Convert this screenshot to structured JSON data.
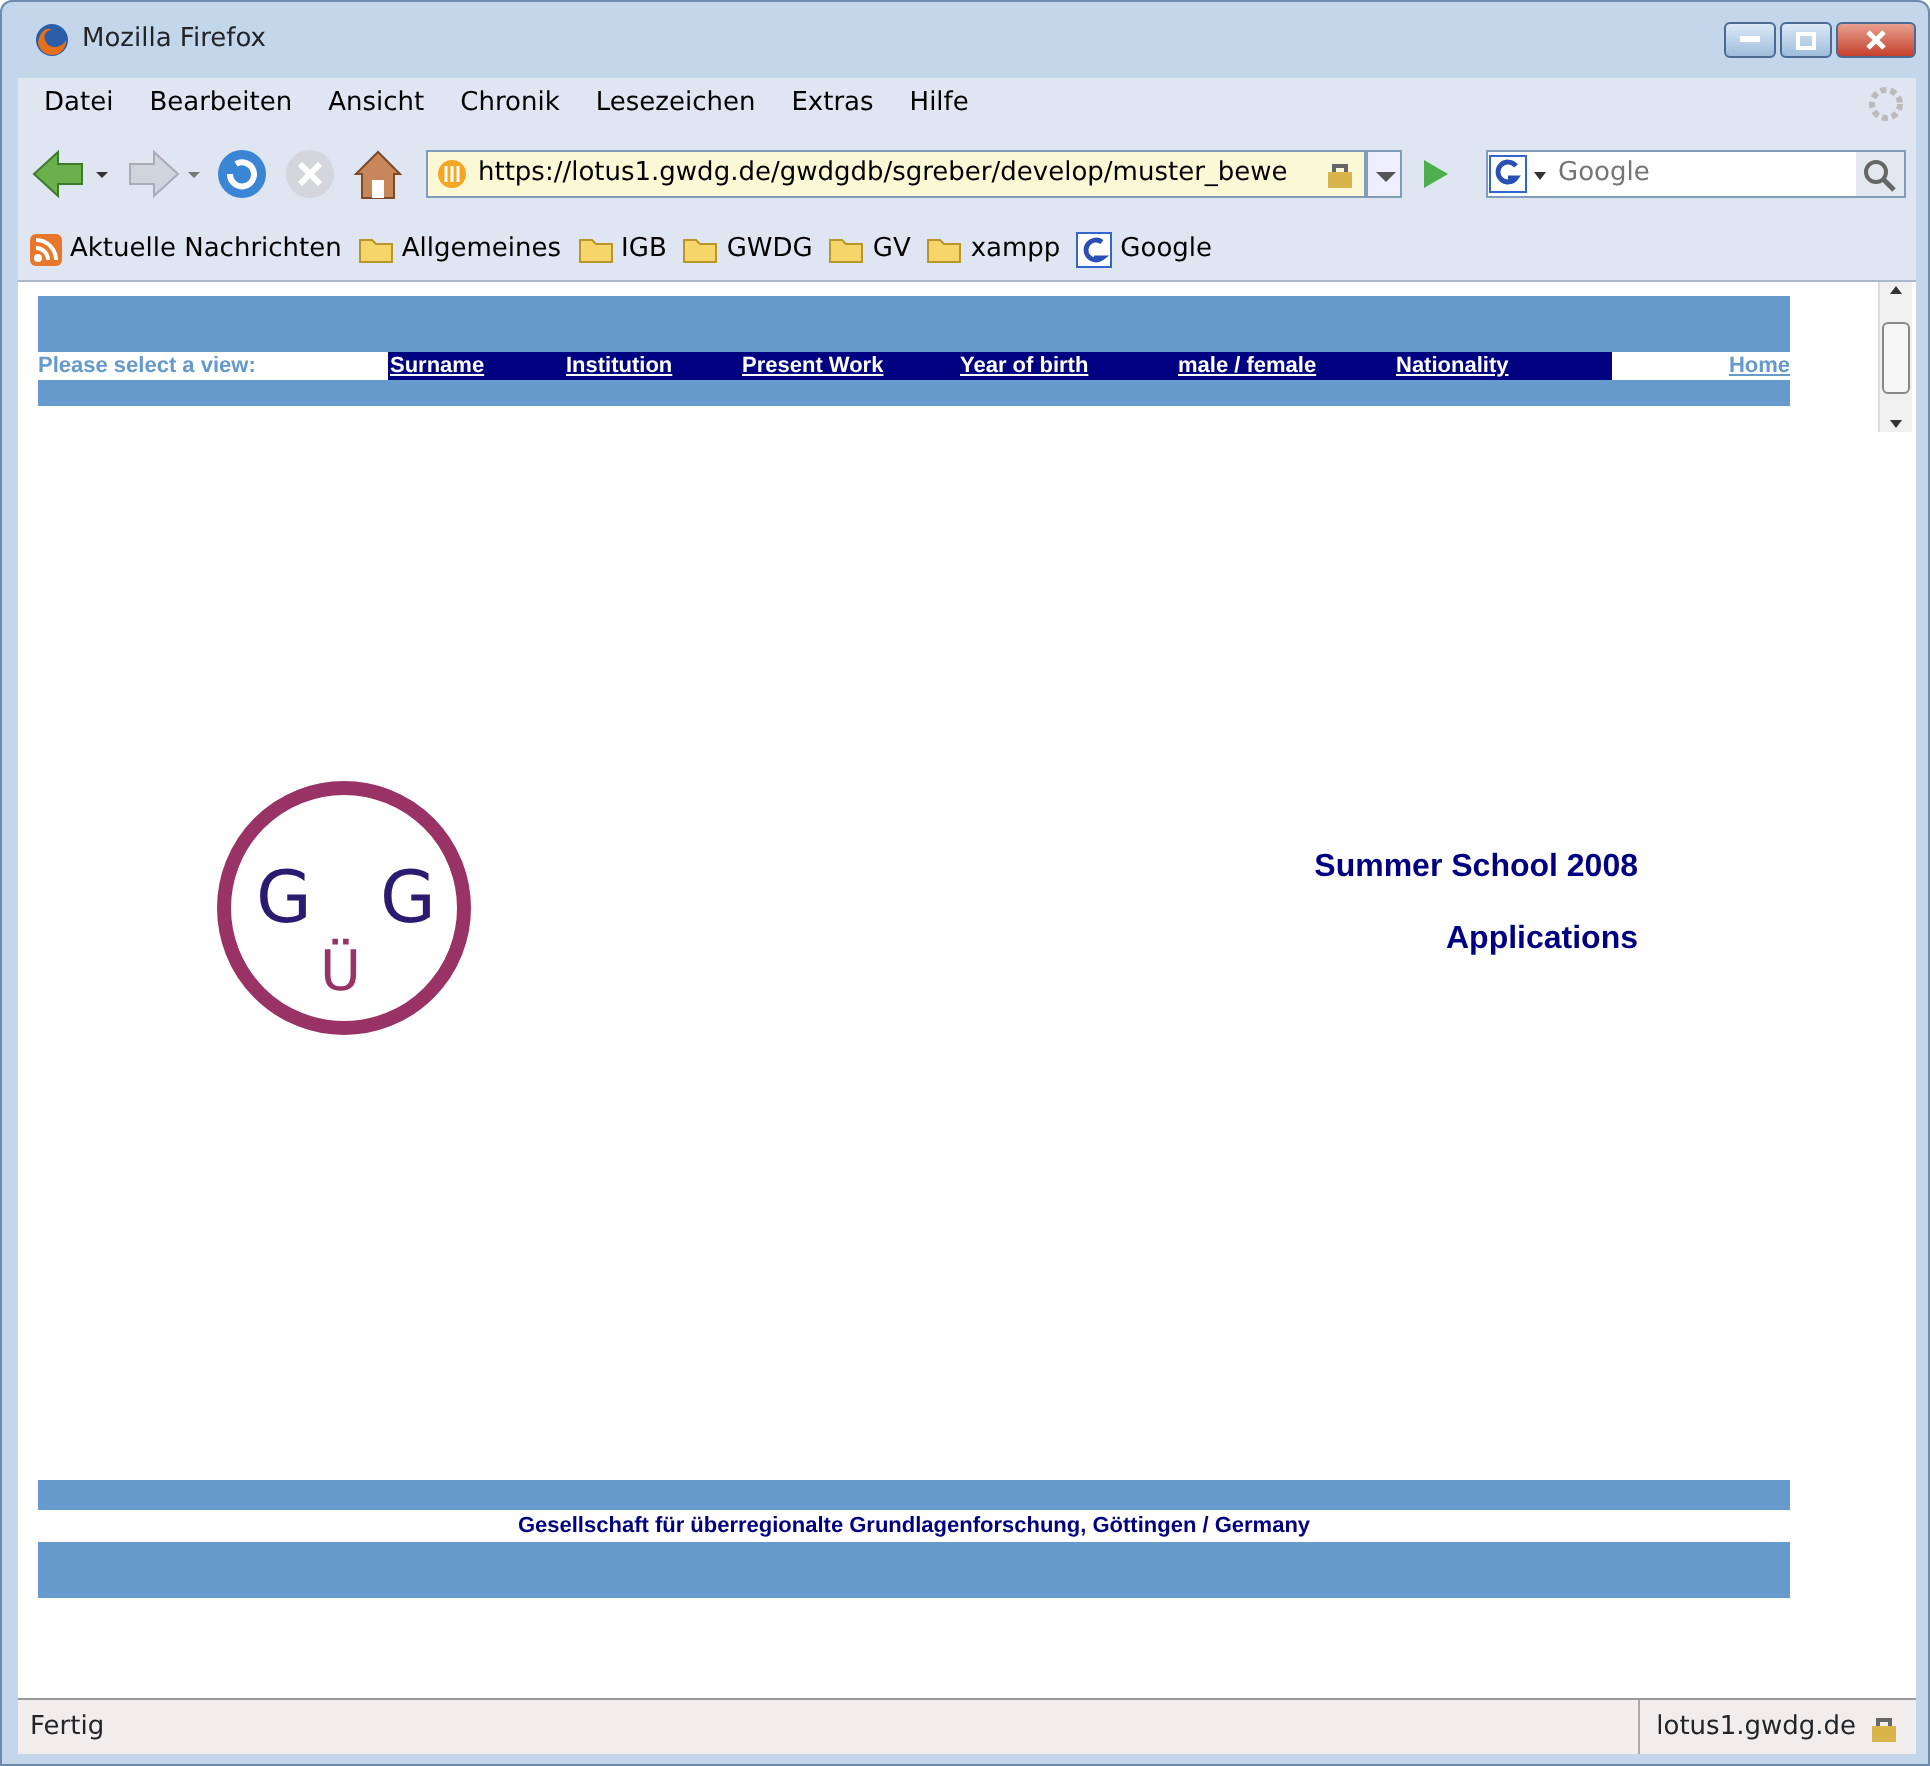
{
  "window": {
    "title": "Mozilla Firefox"
  },
  "menu": [
    "Datei",
    "Bearbeiten",
    "Ansicht",
    "Chronik",
    "Lesezeichen",
    "Extras",
    "Hilfe"
  ],
  "address_bar": {
    "value": "https://lotus1.gwdg.de/gwdgdb/sgreber/develop/muster_bewe"
  },
  "search": {
    "placeholder": "Google"
  },
  "bookmarks": [
    {
      "kind": "feed",
      "label": "Aktuelle Nachrichten"
    },
    {
      "kind": "folder",
      "label": "Allgemeines"
    },
    {
      "kind": "folder",
      "label": "IGB"
    },
    {
      "kind": "folder",
      "label": "GWDG"
    },
    {
      "kind": "folder",
      "label": "GV"
    },
    {
      "kind": "folder",
      "label": "xampp"
    },
    {
      "kind": "google",
      "label": "Google"
    }
  ],
  "page": {
    "view_prompt": "Please select a view:",
    "views": [
      "Surname",
      "Institution",
      "Present Work",
      "Year of birth",
      "male / female",
      "Nationality"
    ],
    "home_link": "Home",
    "logo": {
      "letters": [
        "G",
        "Ü",
        "G"
      ]
    },
    "headings": [
      "Summer School 2008",
      "Applications"
    ],
    "footer": "Gesellschaft für überregionalte Grundlagenforschung, Göttingen / Germany"
  },
  "status_bar": {
    "text": "Fertig",
    "host": "lotus1.gwdg.de"
  }
}
